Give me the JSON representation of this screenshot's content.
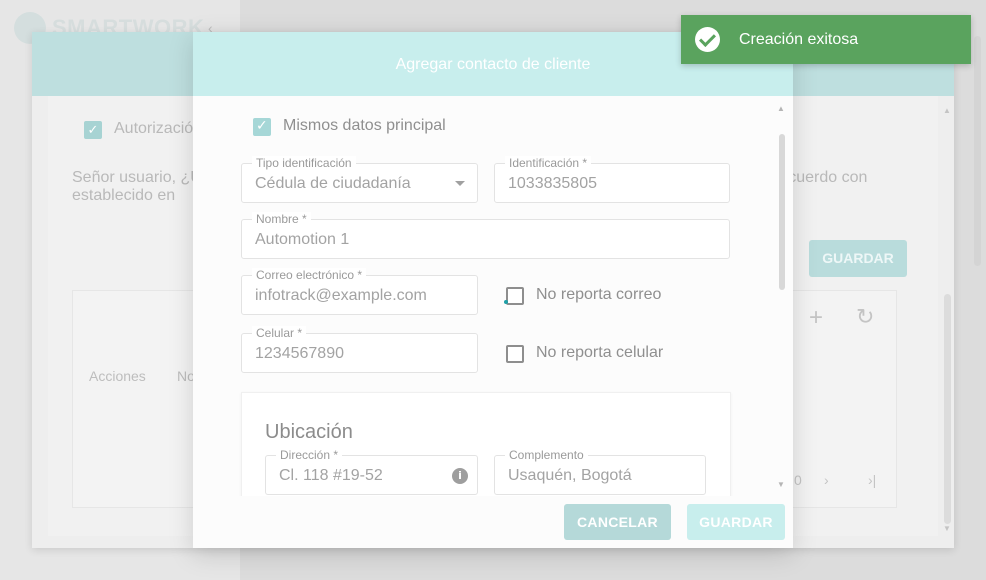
{
  "background": {
    "logo_text": "SMARTWORK",
    "authorization_label": "Autorizació",
    "notice_text": "Señor usuario, ¿U lo establecido en",
    "notice_text_right": "e acuerdo con",
    "save_label": "GUARDAR",
    "table_headers": [
      "Acciones",
      "No"
    ],
    "pagination": [
      "0",
      "›",
      "›|"
    ]
  },
  "modal": {
    "title": "Agregar contacto de cliente",
    "same_data_label": "Mismos datos principal",
    "id_type": {
      "label": "Tipo identificación",
      "value": "Cédula de ciudadanía"
    },
    "identification": {
      "label": "Identificación *",
      "value": "1033835805"
    },
    "name": {
      "label": "Nombre *",
      "value": "Automotion 1"
    },
    "email": {
      "label": "Correo electrónico *",
      "value": "infotrack@example.com"
    },
    "no_email_label": "No reporta correo",
    "mobile": {
      "label": "Celular *",
      "value": "1234567890"
    },
    "no_mobile_label": "No reporta celular",
    "location": {
      "title": "Ubicación",
      "address": {
        "label": "Dirección *",
        "value": "Cl. 118 #19-52"
      },
      "complement": {
        "label": "Complemento",
        "value": "Usaquén, Bogotá"
      }
    },
    "cancel_label": "CANCELAR",
    "save_label": "GUARDAR"
  },
  "toast": {
    "message": "Creación exitosa",
    "icon": "check-circle-icon",
    "color": "#5aa35e"
  }
}
